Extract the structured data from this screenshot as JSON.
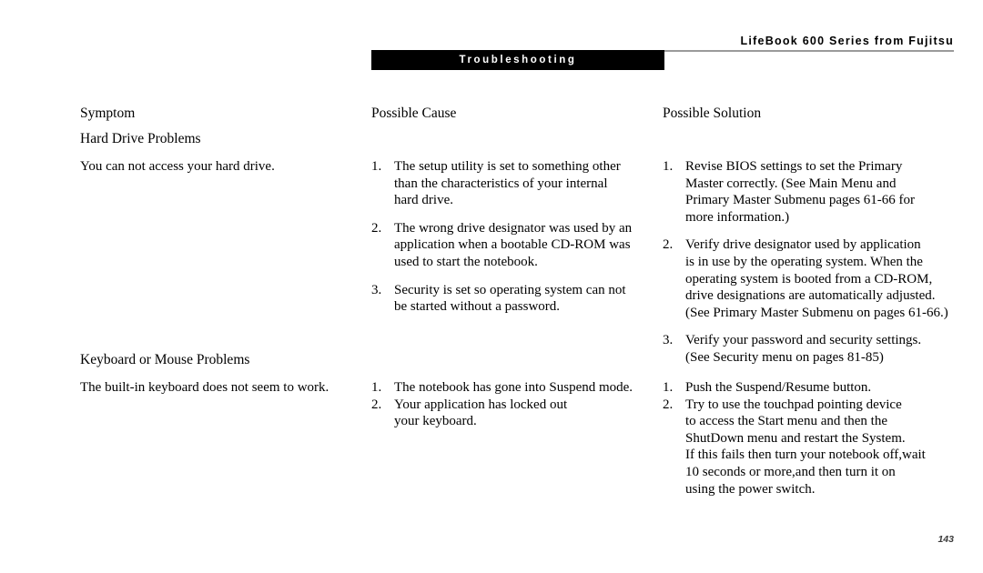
{
  "header": {
    "title": "LifeBook 600 Series from Fujitsu",
    "section_banner": "Troubleshooting"
  },
  "columns": {
    "symptom": "Symptom",
    "possible_cause": "Possible Cause",
    "possible_solution": "Possible Solution"
  },
  "sections": [
    {
      "group_title": "Hard Drive Problems",
      "symptom": "You can not access your hard drive.",
      "causes": [
        {
          "number": "1.",
          "lines": [
            "The setup utility is set to something other",
            "than the characteristics of your internal",
            "hard drive."
          ]
        },
        {
          "number": "2.",
          "lines": [
            "The wrong drive designator was used by an",
            "application when a bootable CD-ROM was",
            "used to start the notebook."
          ]
        },
        {
          "number": "3.",
          "lines": [
            "Security is set so operating system can not",
            "be started without a password."
          ]
        }
      ],
      "solutions": [
        {
          "number": "1.",
          "lines": [
            "Revise BIOS settings to set the Primary",
            "Master correctly. (See Main Menu and",
            "Primary Master Submenu pages 61-66 for",
            "more information.)"
          ]
        },
        {
          "number": "2.",
          "lines": [
            "Verify drive designator used by application",
            "is in use by the operating system. When the",
            "operating system is booted from a CD-ROM,",
            "drive designations are automatically adjusted.",
            "(See Primary Master Submenu on pages 61-66.)"
          ]
        },
        {
          "number": "3.",
          "lines": [
            "Verify your password and security settings.",
            "(See Security menu on pages 81-85)"
          ]
        }
      ]
    },
    {
      "group_title": "Keyboard or Mouse Problems",
      "symptom": "The built-in keyboard does not seem to work.",
      "causes": [
        {
          "number": "1.",
          "lines": [
            "The notebook has gone into Suspend mode."
          ]
        },
        {
          "number": "2.",
          "lines": [
            "Your application has locked out",
            "your keyboard."
          ]
        }
      ],
      "solutions": [
        {
          "number": "1.",
          "lines": [
            "Push the Suspend/Resume button."
          ]
        },
        {
          "number": "2.",
          "lines": [
            "Try to use the touchpad pointing device",
            "to access the Start menu and then the",
            "ShutDown menu and restart the System.",
            "If this fails then turn your notebook  off,wait",
            "10 seconds or more,and then turn it on",
            "using the power switch."
          ]
        }
      ]
    }
  ],
  "footer": {
    "page_number": "143"
  }
}
